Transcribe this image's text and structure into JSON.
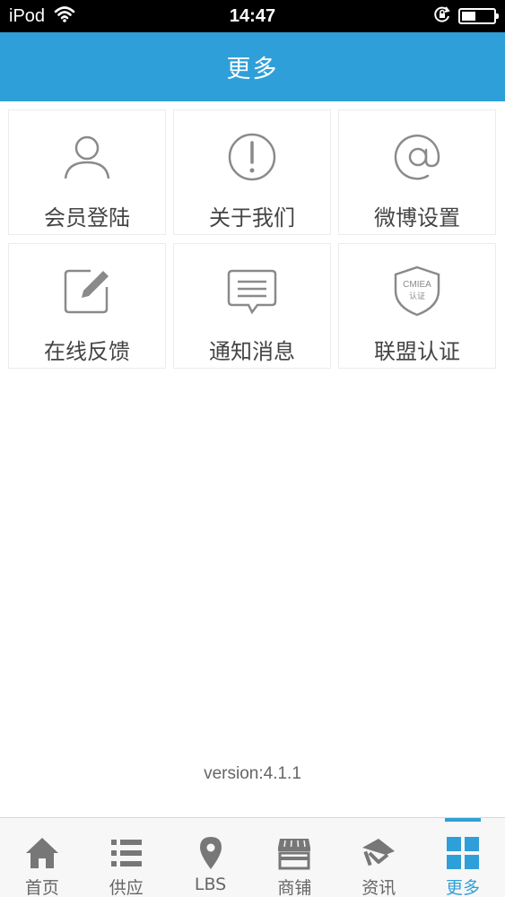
{
  "status_bar": {
    "carrier": "iPod",
    "time": "14:47",
    "icons": [
      "wifi-icon",
      "rotation-lock-icon",
      "battery-icon"
    ]
  },
  "header": {
    "title": "更多"
  },
  "menu": {
    "items": [
      {
        "label": "会员登陆",
        "icon": "user-icon"
      },
      {
        "label": "关于我们",
        "icon": "info-exclamation-icon"
      },
      {
        "label": "微博设置",
        "icon": "at-icon"
      },
      {
        "label": "在线反馈",
        "icon": "edit-icon"
      },
      {
        "label": "通知消息",
        "icon": "message-icon"
      },
      {
        "label": "联盟认证",
        "icon": "shield-badge-icon",
        "badge_lines": [
          "CMIEA",
          "认证"
        ]
      }
    ]
  },
  "version": "version:4.1.1",
  "tab_bar": {
    "tabs": [
      {
        "label": "首页",
        "icon": "home-icon"
      },
      {
        "label": "供应",
        "icon": "list-icon"
      },
      {
        "label": "LBS",
        "icon": "location-pin-icon"
      },
      {
        "label": "商铺",
        "icon": "store-icon"
      },
      {
        "label": "资讯",
        "icon": "news-icon"
      },
      {
        "label": "更多",
        "icon": "grid-icon",
        "active": true
      }
    ]
  },
  "colors": {
    "primary": "#2f9fd9",
    "icon_gray": "#8a8a8a",
    "tab_icon_gray": "#777777"
  }
}
